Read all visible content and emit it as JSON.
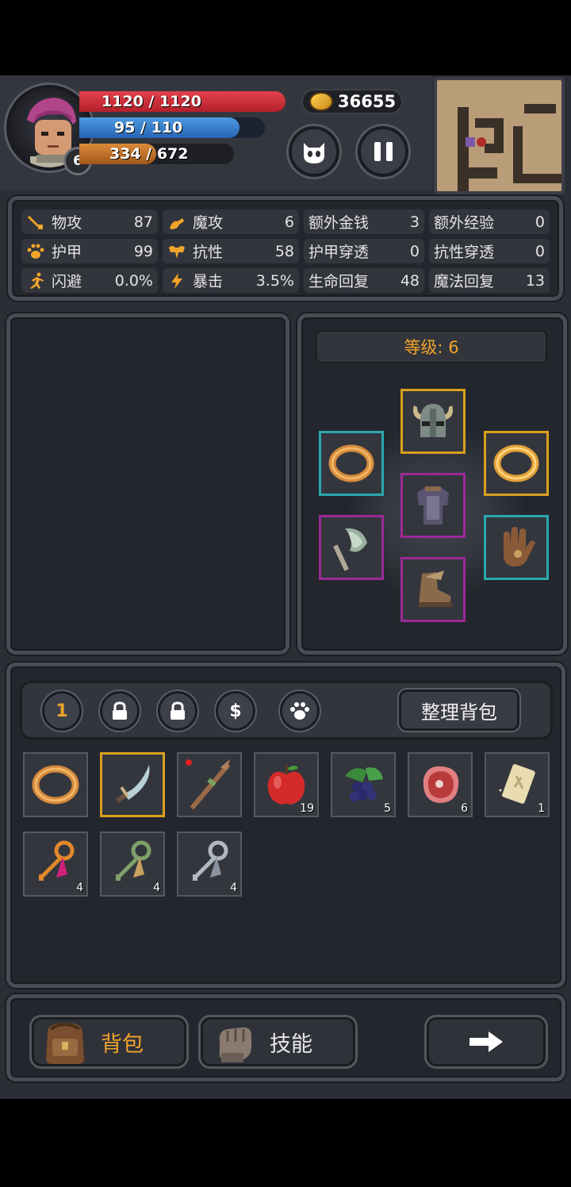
{
  "player": {
    "level": "6",
    "hp_text": "1120 / 1120",
    "hp_ratio": 1.0,
    "mp_text": "95 / 110",
    "mp_ratio": 0.8636,
    "xp_text": "334 / 672",
    "xp_ratio": 0.497
  },
  "gold": "36655",
  "stats": [
    {
      "icon": "sword-icon",
      "label": "物攻",
      "value": "87"
    },
    {
      "icon": "magic-hand-icon",
      "label": "魔攻",
      "value": "6"
    },
    {
      "icon": "",
      "label": "额外金钱",
      "value": "3"
    },
    {
      "icon": "",
      "label": "额外经验",
      "value": "0"
    },
    {
      "icon": "paw-icon",
      "label": "护甲",
      "value": "99"
    },
    {
      "icon": "muscle-icon",
      "label": "抗性",
      "value": "58"
    },
    {
      "icon": "",
      "label": "护甲穿透",
      "value": "0"
    },
    {
      "icon": "",
      "label": "抗性穿透",
      "value": "0"
    },
    {
      "icon": "running-icon",
      "label": "闪避",
      "value": "0.0%"
    },
    {
      "icon": "lightning-icon",
      "label": "暴击",
      "value": "3.5%"
    },
    {
      "icon": "",
      "label": "生命回复",
      "value": "48"
    },
    {
      "icon": "",
      "label": "魔法回复",
      "value": "13"
    }
  ],
  "equipment": {
    "level_text": "等级: 6"
  },
  "inventory": {
    "active_tab": "1",
    "sort_label": "整理背包",
    "items": [
      {
        "name": "ring",
        "qty": ""
      },
      {
        "name": "dagger",
        "qty": ""
      },
      {
        "name": "staff",
        "qty": ""
      },
      {
        "name": "apple",
        "qty": "19"
      },
      {
        "name": "berries",
        "qty": "5"
      },
      {
        "name": "meat",
        "qty": "6"
      },
      {
        "name": "rune-scroll",
        "qty": "1"
      },
      {
        "name": "orange-key",
        "qty": "4"
      },
      {
        "name": "green-key",
        "qty": "4"
      },
      {
        "name": "silver-key",
        "qty": "4"
      }
    ]
  },
  "nav": {
    "bag_label": "背包",
    "skill_label": "技能"
  },
  "colors": {
    "accent_orange": "#f0a429",
    "hp_red": "#c9303a",
    "mp_blue": "#2f73c4",
    "xp_orange": "#c06e24",
    "legendary_border": "#d8a11c",
    "rare_border": "#28a8ad",
    "epic_border": "#9b2a96"
  }
}
